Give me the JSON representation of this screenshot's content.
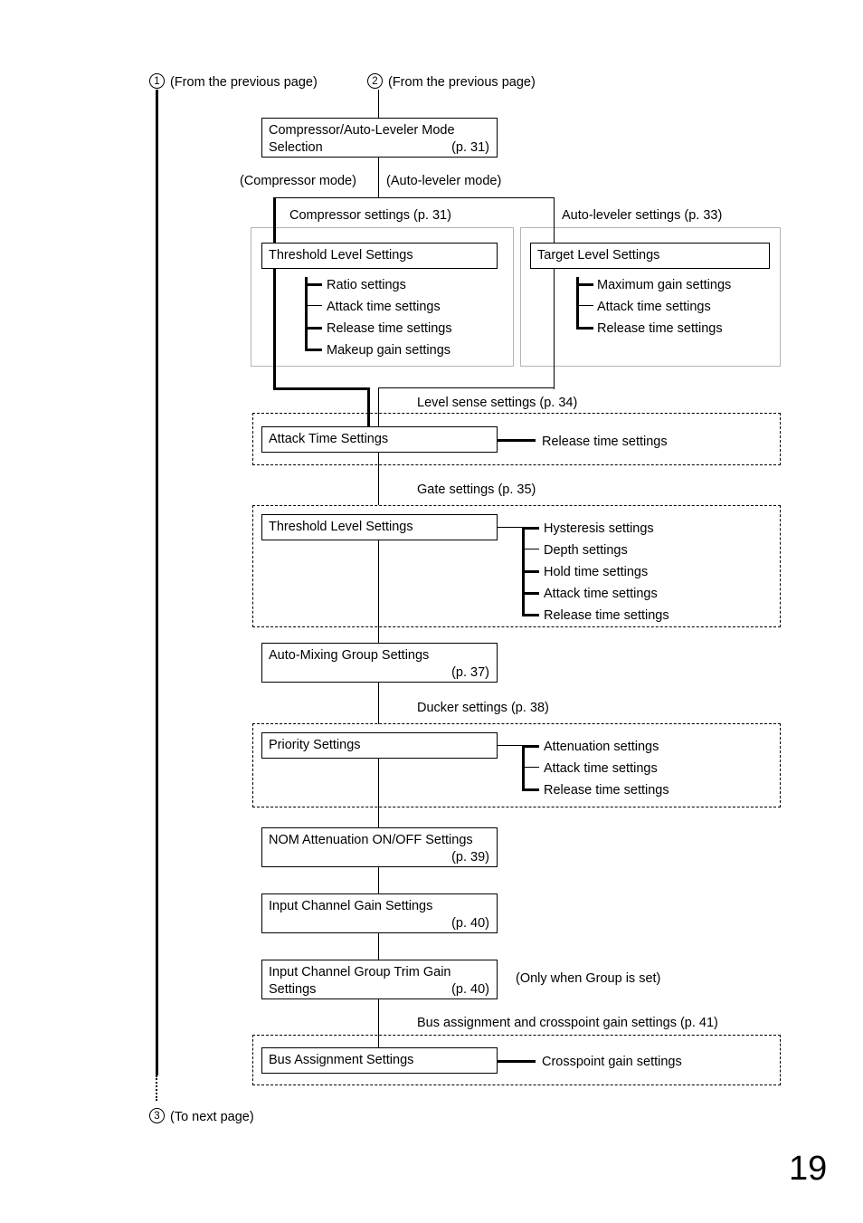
{
  "page": {
    "number": "19"
  },
  "entries": {
    "from_prev_1_marker": "1",
    "from_prev_1_label": "(From the previous page)",
    "from_prev_2_marker": "2",
    "from_prev_2_label": "(From the previous page)",
    "to_next_marker": "3",
    "to_next_label": "(To next page)"
  },
  "mode_selection": {
    "line1": "Compressor/Auto-Leveler Mode",
    "line2": "Selection",
    "page_ref": "(p. 31)"
  },
  "branch_labels": {
    "compressor_mode": "(Compressor mode)",
    "auto_leveler_mode": "(Auto-leveler mode)"
  },
  "groups": {
    "compressor": {
      "title": "Compressor settings (p. 31)",
      "head": "Threshold Level Settings",
      "items": [
        "Ratio settings",
        "Attack time settings",
        "Release time settings",
        "Makeup gain settings"
      ]
    },
    "auto_leveler": {
      "title": "Auto-leveler settings (p. 33)",
      "head": "Target Level Settings",
      "items": [
        "Maximum gain settings",
        "Attack time settings",
        "Release time settings"
      ]
    },
    "level_sense": {
      "title": "Level sense settings (p. 34)",
      "head": "Attack Time Settings",
      "items": [
        "Release time settings"
      ]
    },
    "gate": {
      "title": "Gate settings (p. 35)",
      "head": "Threshold Level Settings",
      "items": [
        "Hysteresis settings",
        "Depth settings",
        "Hold time settings",
        "Attack time settings",
        "Release time settings"
      ]
    },
    "ducker": {
      "title": "Ducker settings (p. 38)",
      "head": "Priority Settings",
      "items": [
        "Attenuation settings",
        "Attack time settings",
        "Release time settings"
      ]
    },
    "bus_assignment": {
      "title": "Bus assignment and crosspoint gain settings (p. 41)",
      "head": "Bus Assignment Settings",
      "items": [
        "Crosspoint gain settings"
      ]
    }
  },
  "nodes": {
    "auto_mixing": {
      "line1": "Auto-Mixing Group Settings",
      "page_ref": "(p. 37)"
    },
    "nom_attenuation": {
      "line1": "NOM Attenuation ON/OFF Settings",
      "page_ref": "(p. 39)"
    },
    "input_channel_gain": {
      "line1": "Input Channel Gain Settings",
      "page_ref": "(p. 40)"
    },
    "input_channel_group_trim": {
      "line1": "Input Channel Group Trim Gain",
      "line2": "Settings",
      "page_ref": "(p. 40)",
      "note": "(Only when Group is set)"
    }
  }
}
